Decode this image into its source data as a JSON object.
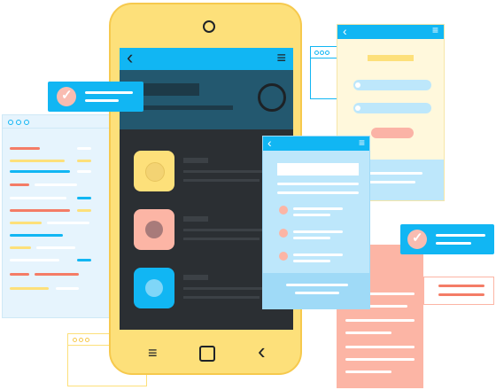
{
  "illustration": {
    "colors": {
      "phone_body": "#fde07a",
      "accent_blue": "#11b6f3",
      "light_blue": "#e6f4fd",
      "salmon": "#fcb5a5",
      "dark_screen": "#2b2f33",
      "yellow": "#fde07a"
    },
    "phone": {
      "nav_icons": [
        "menu-icon",
        "home-square-icon",
        "back-chevron-icon"
      ],
      "list_item_thumbs": [
        "yellow",
        "salmon",
        "blue"
      ]
    },
    "icons": {
      "back": "‹",
      "hamburger": "≡",
      "check": "✓"
    }
  }
}
